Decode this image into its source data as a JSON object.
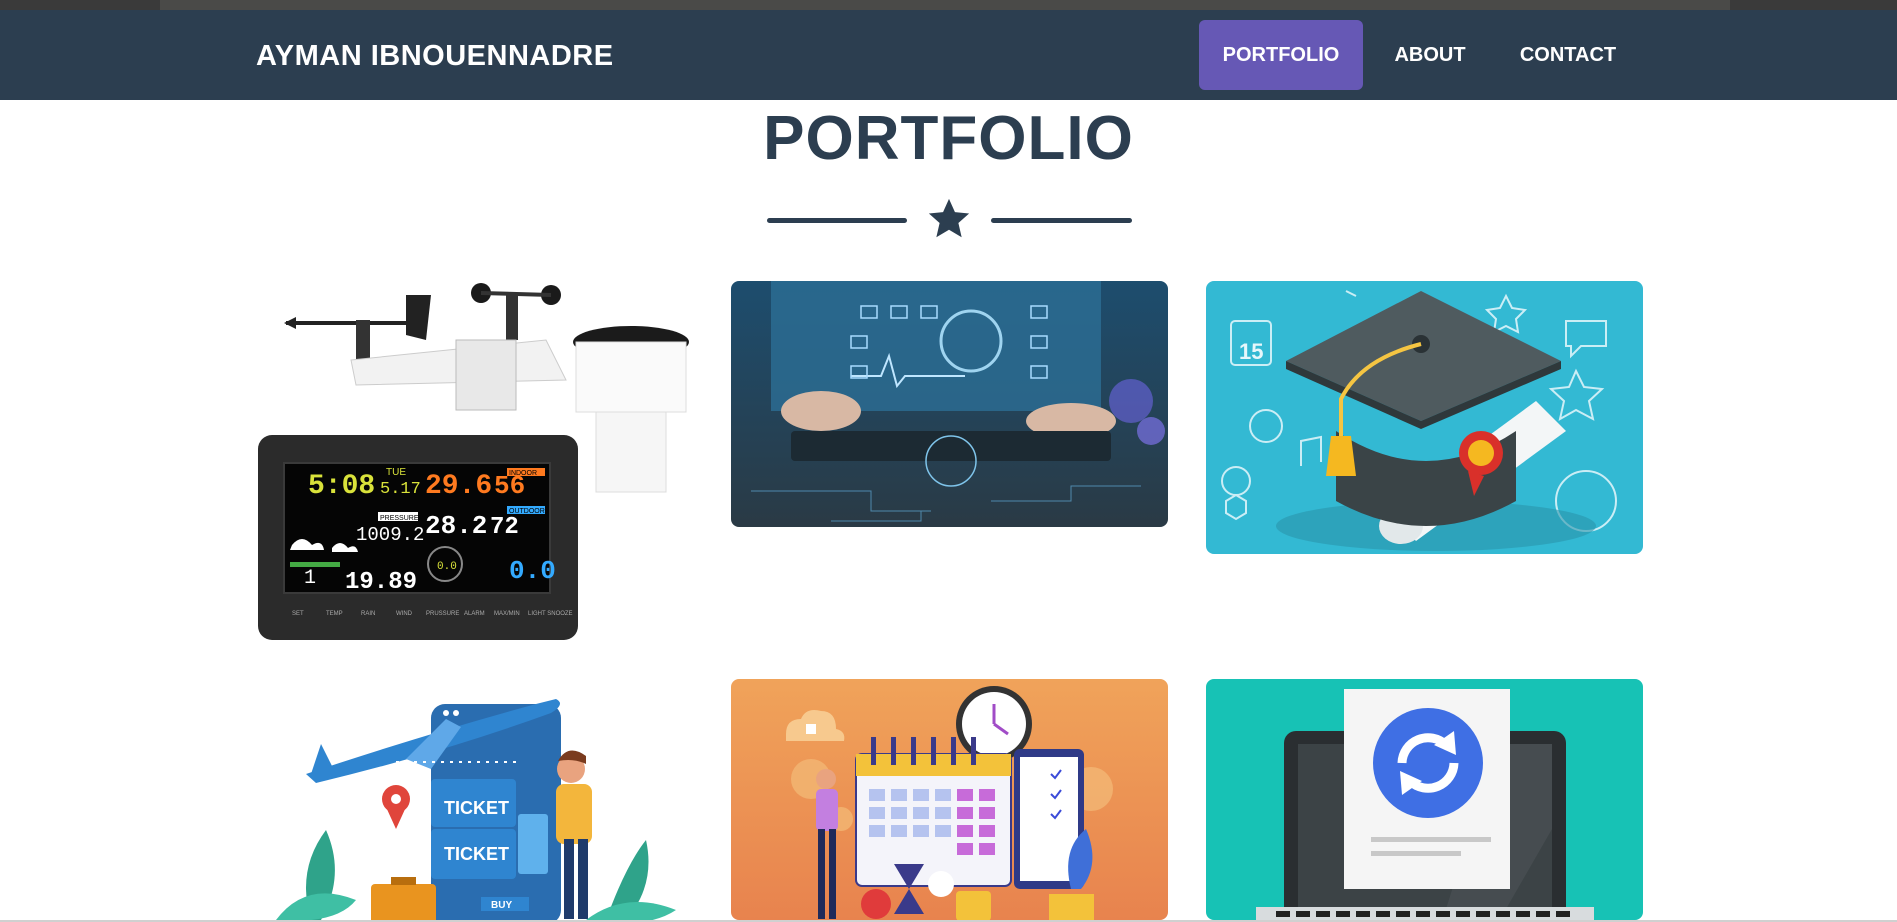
{
  "brand": "AYMAN IBNOUENNADRE",
  "nav": [
    {
      "label": "PORTFOLIO",
      "active": true
    },
    {
      "label": "ABOUT",
      "active": false
    },
    {
      "label": "CONTACT",
      "active": false
    }
  ],
  "section": {
    "title": "PORTFOLIO"
  },
  "portfolio_items": [
    {
      "image": "weather-station",
      "display": {
        "time": "5:08",
        "day": "TUE",
        "date": "5.17",
        "temp_in": "29.6",
        "hum_in": "56",
        "pressure_label": "PRESSURE",
        "pressure": "1009.2",
        "temp_out": "28.2",
        "hum_out": "72",
        "wind": "0.0",
        "uv": "1",
        "light": "19.89",
        "indoor": "INDOOR",
        "outdoor": "OUTDOOR",
        "buttons": [
          "SET",
          "TEMP",
          "RAIN",
          "WIND",
          "PRUSSURE",
          "ALARM",
          "MAX/MIN",
          "LIGHT SNOOZE"
        ]
      }
    },
    {
      "image": "digital-health-doctor"
    },
    {
      "image": "graduation-cap-diploma",
      "calendar_number": "15"
    },
    {
      "image": "flight-ticket-booking",
      "ticket_labels": [
        "TICKET",
        "TICKET"
      ],
      "buy_label": "BUY"
    },
    {
      "image": "calendar-planning"
    },
    {
      "image": "laptop-sync-document"
    }
  ],
  "colors": {
    "navbar": "#2c3e50",
    "active_nav": "#6658b5",
    "title": "#2c3e50"
  }
}
